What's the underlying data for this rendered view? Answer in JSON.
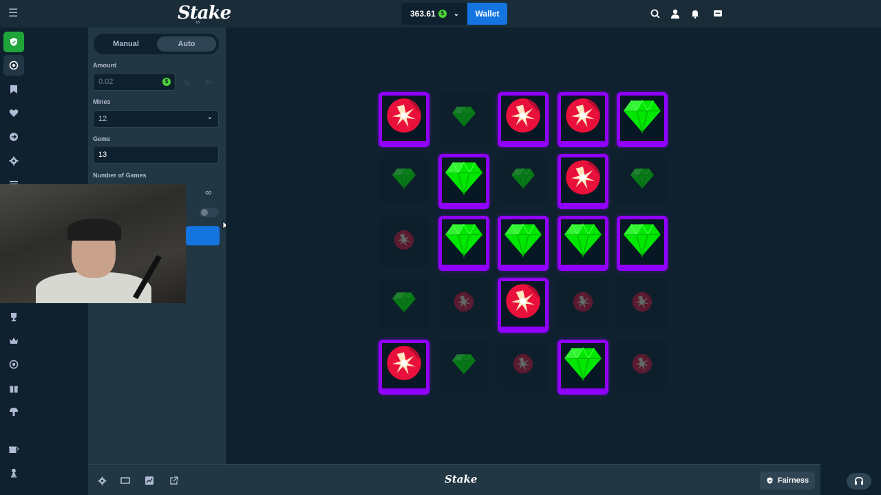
{
  "header": {
    "logo": "Stake",
    "logo_sub": ".us",
    "balance": "363.61",
    "currency_symbol": "$",
    "wallet_label": "Wallet"
  },
  "panel": {
    "tabs": [
      "Manual",
      "Auto"
    ],
    "active_tab": "Auto",
    "amount_label": "Amount",
    "amount_value": "0.02",
    "half_label": "½",
    "double_label": "2×",
    "mines_label": "Mines",
    "mines_value": "12",
    "gems_label": "Gems",
    "gems_value": "13",
    "games_label": "Number of Games",
    "games_symbol": "∞"
  },
  "board": {
    "rows": [
      [
        "mine-rev",
        "gem-dim",
        "mine-rev",
        "mine-rev",
        "gem-rev"
      ],
      [
        "gem-dim",
        "gem-rev",
        "gem-dim",
        "mine-rev",
        "gem-dim"
      ],
      [
        "mine-dim",
        "gem-rev",
        "gem-rev",
        "gem-rev",
        "gem-rev"
      ],
      [
        "gem-dim",
        "mine-dim",
        "mine-rev",
        "mine-dim",
        "mine-dim"
      ],
      [
        "mine-rev",
        "gem-dim",
        "mine-dim",
        "gem-rev",
        "mine-dim"
      ]
    ]
  },
  "footer": {
    "logo": "Stake",
    "fairness_label": "Fairness"
  },
  "colors": {
    "accent": "#1475e1",
    "selected_border": "#9000ff",
    "gem": "#00e701",
    "mine": "#e9113c",
    "active_rail": "#1fa43a"
  },
  "icons": {
    "rail": [
      "menu-icon",
      "shield-icon",
      "casino-icon",
      "bookmark-icon",
      "heart-icon",
      "arrow-icon",
      "settings-icon",
      "list-icon",
      "trophy-icon",
      "crown-icon",
      "target-icon",
      "gift-icon",
      "mushroom-icon",
      "gift-more-icon",
      "chess-icon"
    ],
    "top": [
      "search-icon",
      "user-icon",
      "bell-icon",
      "chat-icon"
    ],
    "bottom": [
      "settings-icon",
      "theatre-icon",
      "chart-icon",
      "popout-icon"
    ]
  }
}
